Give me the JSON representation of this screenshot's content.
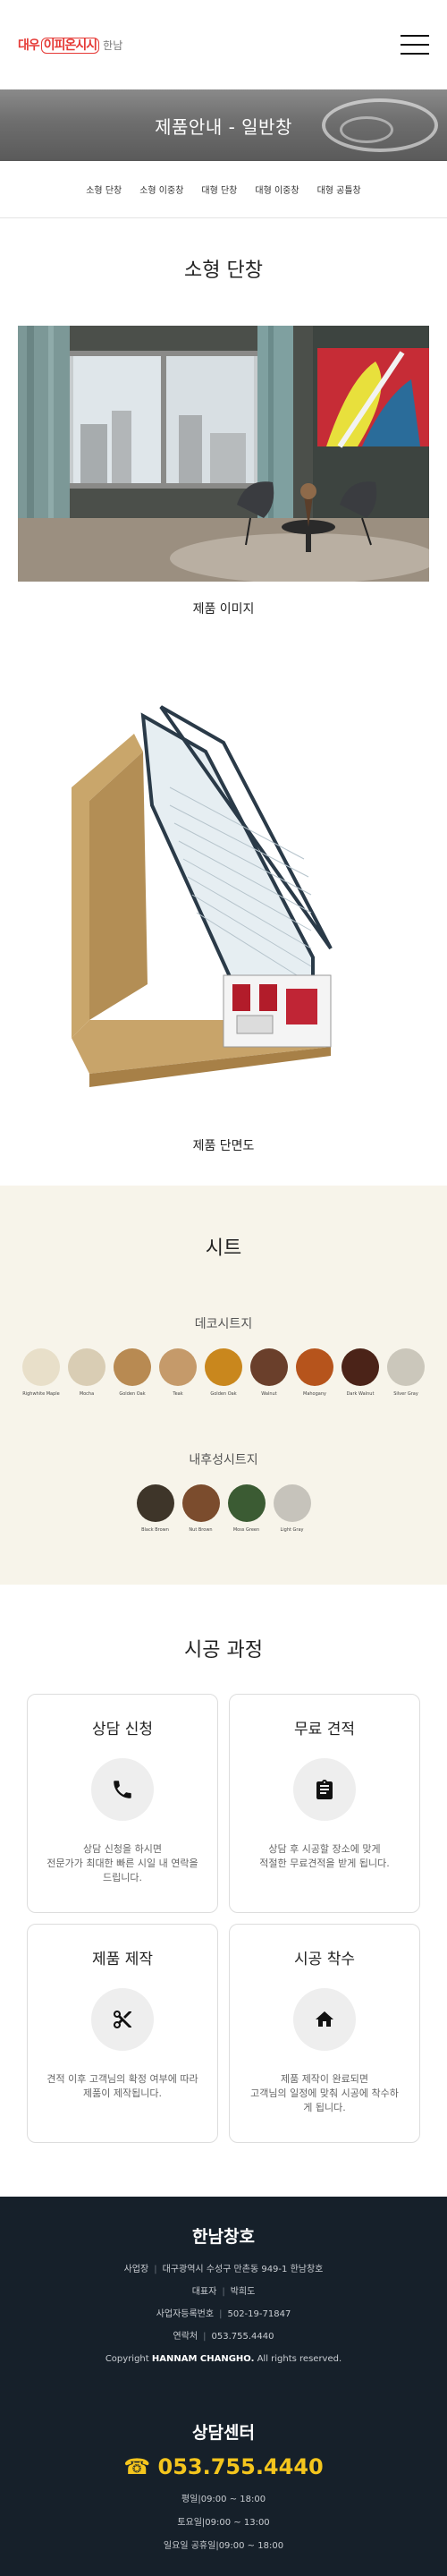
{
  "header": {
    "logo_main": "대우",
    "logo_brand": "이피온시시",
    "logo_sub": "한남"
  },
  "hero": {
    "title": "제품안내 - 일반창"
  },
  "subnav": [
    "소형 단창",
    "소형 이중창",
    "대형 단창",
    "대형 이중창",
    "대형 공틀창"
  ],
  "product": {
    "title": "소형 단창",
    "image_caption": "제품 이미지",
    "section_caption": "제품 단면도"
  },
  "sheets": {
    "title": "시트",
    "groups": [
      {
        "label": "데코시트지",
        "items": [
          {
            "name": "Righwhite Maple",
            "color": "#e8dfc9"
          },
          {
            "name": "Mocha",
            "color": "#d9cdb4"
          },
          {
            "name": "Golden Oak",
            "color": "#b88a52"
          },
          {
            "name": "Teak",
            "color": "#c59a6a"
          },
          {
            "name": "Golden Oak",
            "color": "#c9871d"
          },
          {
            "name": "Walnut",
            "color": "#6a3f2b"
          },
          {
            "name": "Mahogany",
            "color": "#b6541c"
          },
          {
            "name": "Dark Walnut",
            "color": "#4b2318"
          },
          {
            "name": "Silver Gray",
            "color": "#cbc7bb"
          }
        ]
      },
      {
        "label": "내후성시트지",
        "items": [
          {
            "name": "Black Brown",
            "color": "#3e3529"
          },
          {
            "name": "Nut Brown",
            "color": "#7b4c2d"
          },
          {
            "name": "Moss Green",
            "color": "#3b5b33"
          },
          {
            "name": "Light Gray",
            "color": "#c6c3bb"
          }
        ]
      }
    ]
  },
  "process": {
    "title": "시공 과정",
    "cards": [
      {
        "title": "상담 신청",
        "icon": "phone-icon",
        "desc": [
          "상담 신청을 하시면",
          "전문가가 최대한 빠른 시일 내 연락을",
          "드립니다."
        ]
      },
      {
        "title": "무료 견적",
        "icon": "clipboard-icon",
        "desc": [
          "상담 후 시공할 장소에 맞게",
          "적절한 무료견적을 받게 됩니다."
        ]
      },
      {
        "title": "제품 제작",
        "icon": "scissors-icon",
        "desc": [
          "견적 이후 고객님의 확정 여부에 따라",
          "제품이 제작됩니다."
        ]
      },
      {
        "title": "시공 착수",
        "icon": "home-icon",
        "desc": [
          "제품 제작이 완료되면",
          "고객님의 일정에 맞춰 시공에 착수하",
          "게 됩니다."
        ]
      }
    ]
  },
  "footer": {
    "company": "한남창호",
    "address_label": "사업장",
    "address": "대구광역시 수성구 만촌동 949-1 한남창호",
    "ceo_label": "대표자",
    "ceo": "박희도",
    "biz_label": "사업자등록번호",
    "biz": "502-19-71847",
    "tel_label": "연락처",
    "tel": "053.755.4440",
    "copyright_prefix": "Copyright",
    "copyright_brand": "HANNAM CHANGHO.",
    "copyright_suffix": "All rights reserved.",
    "center_title": "상담센터",
    "phone": "☎ 053.755.4440",
    "hours": [
      {
        "day": "평일",
        "time": "09:00 ~ 18:00"
      },
      {
        "day": "토요일",
        "time": "09:00 ~ 13:00"
      },
      {
        "day": "일요일 공휴일",
        "time": "09:00 ~ 18:00"
      }
    ]
  }
}
